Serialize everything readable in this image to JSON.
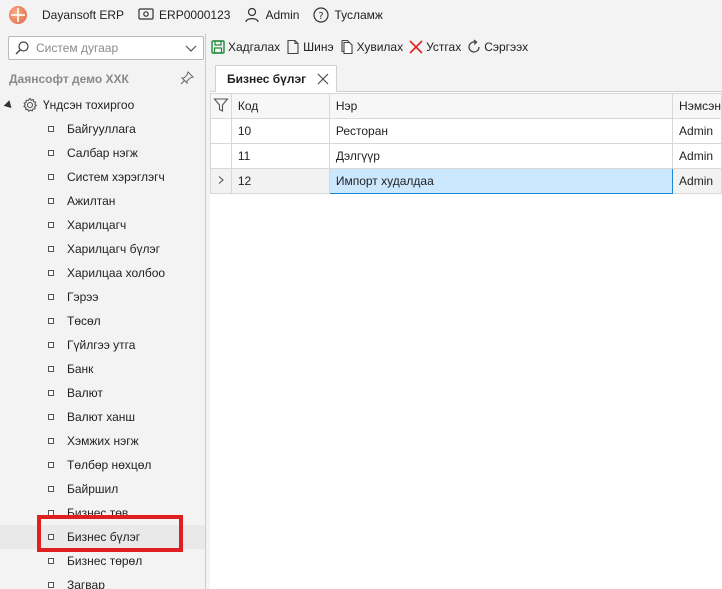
{
  "titlebar": {
    "app_name": "Dayansoft ERP",
    "instance": "ERP0000123",
    "user": "Admin",
    "help": "Тусламж"
  },
  "left_panel": {
    "search_placeholder": "Систем дугаар",
    "company": "Даянсофт демо ХХК",
    "root_label": "Үндсэн тохиргоо",
    "items": [
      "Байгууллага",
      "Салбар нэгж",
      "Систем хэрэглэгч",
      "Ажилтан",
      "Харилцагч",
      "Харилцагч бүлэг",
      "Харилцаа холбоо",
      "Гэрээ",
      "Төсөл",
      "Гүйлгээ утга",
      "Банк",
      "Валют",
      "Валют ханш",
      "Хэмжих нэгж",
      "Төлбөр нөхцөл",
      "Байршил",
      "Бизнес төв",
      "Бизнес бүлэг",
      "Бизнес төрөл",
      "Загвар"
    ],
    "selected_item": "Бизнес бүлэг"
  },
  "toolbar": {
    "save": "Хадгалах",
    "new": "Шинэ",
    "copy": "Хувилах",
    "delete": "Устгах",
    "refresh": "Сэргээх"
  },
  "tab": {
    "label": "Бизнес бүлэг"
  },
  "grid": {
    "columns": [
      "Код",
      "Нэр",
      "Нэмсэн"
    ],
    "rows": [
      {
        "code": "10",
        "name": "Ресторан",
        "added": "Admin"
      },
      {
        "code": "11",
        "name": "Дэлгүүр",
        "added": "Admin"
      },
      {
        "code": "12",
        "name": "Импорт худалдаа",
        "added": "Admin"
      }
    ]
  },
  "colors": {
    "accent": "#1c88d8",
    "save_icon": "#1f8a3a",
    "delete_icon": "#e02020",
    "highlight_box": "#e02020"
  }
}
